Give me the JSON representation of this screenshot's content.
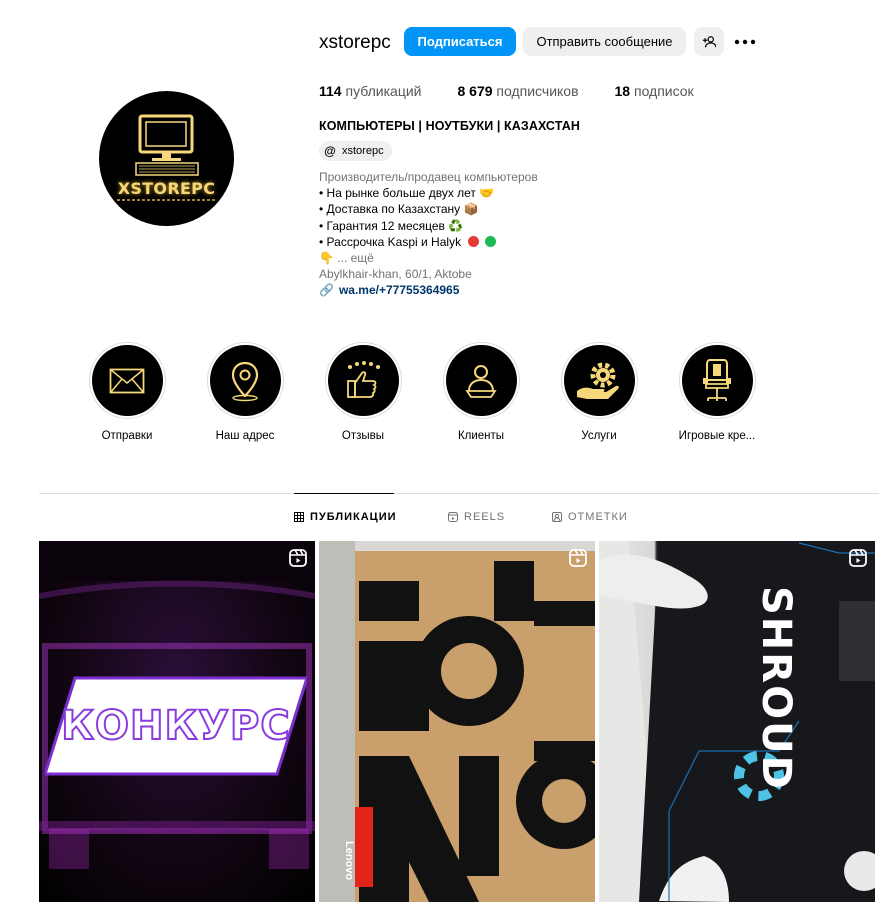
{
  "profile": {
    "username": "xstorepc",
    "follow_label": "Подписаться",
    "message_label": "Отправить сообщение",
    "avatar_brand": "XSTOREPC",
    "stats": {
      "posts_count": "114",
      "posts_label": "публикаций",
      "followers_count": "8 679",
      "followers_label": "подписчиков",
      "following_count": "18",
      "following_label": "подписок"
    },
    "full_name": "КОМПЬЮТЕРЫ | НОУТБУКИ | КАЗАХСТАН",
    "threads_handle": "xstorepc",
    "bio": {
      "category": "Производитель/продавец компьютеров",
      "line1": "• На рынке больше двух лет 🤝",
      "line2": "• Доставка по Казахстану 📦",
      "line3": "• Гарантия 12 месяцев ♻️",
      "line4": "• Рассрочка Kaspi и Halyk",
      "line5_emoji": "👇",
      "more": " ... ещё",
      "location": "Abylkhair-khan, 60/1, Aktobe",
      "link": "wa.me/+77755364965"
    }
  },
  "highlights": [
    {
      "label": "Отправки",
      "icon": "envelope-icon"
    },
    {
      "label": "Наш адрес",
      "icon": "location-pin-icon"
    },
    {
      "label": "Отзывы",
      "icon": "thumbs-up-stars-icon"
    },
    {
      "label": "Клиенты",
      "icon": "client-icon"
    },
    {
      "label": "Услуги",
      "icon": "gear-hand-icon"
    },
    {
      "label": "Игровые кре...",
      "icon": "gaming-chair-icon"
    }
  ],
  "tabs": {
    "posts": "ПУБЛИКАЦИИ",
    "reels": "REELS",
    "tagged": "ОТМЕТКИ"
  },
  "posts": [
    {
      "overlay_text": "КОНКУРС",
      "type": "reel"
    },
    {
      "overlay_text": "Lenovo",
      "type": "reel"
    },
    {
      "overlay_text": "SHROUD",
      "type": "reel"
    }
  ],
  "colors": {
    "accent": "#0095f6",
    "gold": "#f6d77a",
    "muted": "#737373",
    "link": "#00376b",
    "kaspi_red": "#e53935",
    "halyk_green": "#1db954"
  }
}
